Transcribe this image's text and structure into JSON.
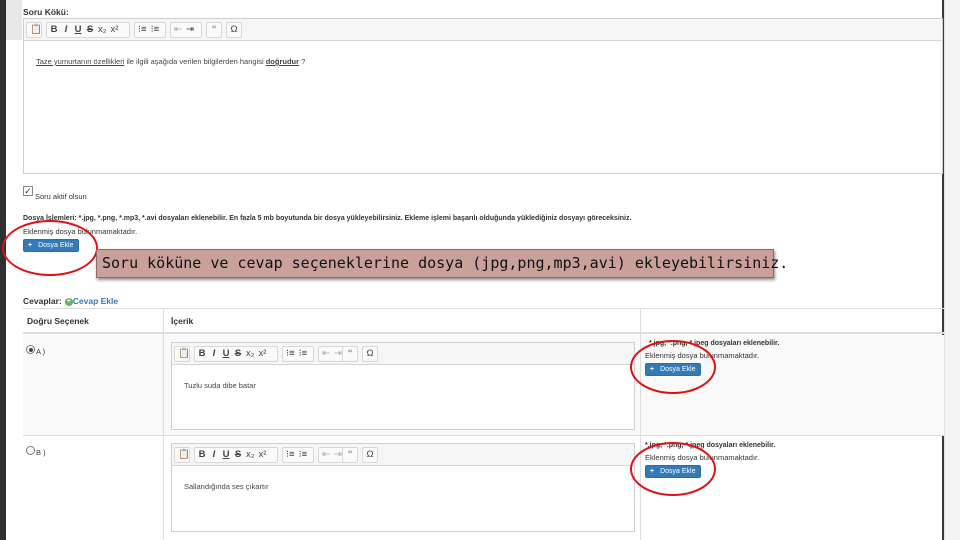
{
  "question": {
    "label": "Soru Kökü:",
    "toolbar": [
      "B",
      "I",
      "U",
      "S",
      "x₂",
      "x²",
      "⁝≡",
      "⁝≡",
      "⇤",
      "⇥",
      "❝",
      "Ω"
    ],
    "text_prefix": "Taze yumurtanın özellikleri",
    "text_middle": " ile ilgili aşağıda verilen bilgilerden hangisi ",
    "text_emph": "doğrudur",
    "text_suffix": " ?"
  },
  "active": {
    "checkbox_glyph": "✓",
    "label": "Soru aktif olsun"
  },
  "files": {
    "label_bold": "Dosya İşlemleri:",
    "label_rest": " *.jpg, *.png, *.mp3, *.avi dosyaları eklenebilir. En fazla 5 mb boyutunda bir dosya yükleyebilirsiniz. Ekleme işlemi başarılı olduğunda yüklediğiniz dosyayı göreceksiniz.",
    "none_text": "Eklenmiş dosya bulunmamaktadır.",
    "add_button": "Dosya Ekle"
  },
  "callout": "Soru köküne ve cevap seçeneklerine  dosya (jpg,png,mp3,avi) ekleyebilirsiniz.",
  "answers": {
    "label": "Cevaplar:",
    "add_link": "Cevap Ekle",
    "col_correct": "Doğru Seçenek",
    "col_content": "İçerik",
    "rows": [
      {
        "option": "A )",
        "selected": true,
        "text": "Tuzlu suda dibe batar",
        "file_types": "*.jpg, *.png, *.jpeg dosyaları eklenebilir.",
        "none_text": "Eklenmiş dosya bulunmamaktadır.",
        "add_button": "Dosya Ekle"
      },
      {
        "option": "B )",
        "selected": false,
        "text": "Sallandığında ses çıkartır",
        "file_types": "*.jpg, *.png, *.jpeg dosyaları eklenebilir.",
        "none_text": "Eklenmiş dosya bulunmamaktadır.",
        "add_button": "Dosya Ekle"
      }
    ]
  },
  "colors": {
    "accent": "#337ab7",
    "highlight": "#e01010",
    "callout_bg": "#c9a19a"
  }
}
